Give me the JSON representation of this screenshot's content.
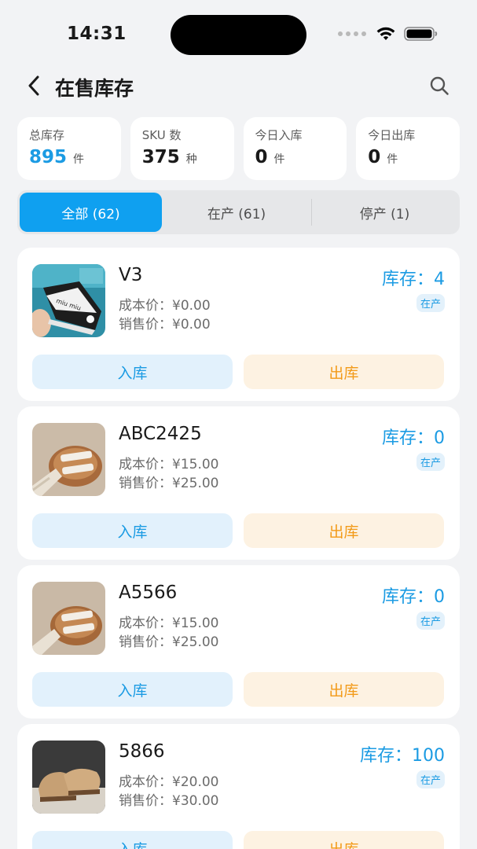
{
  "status_bar": {
    "time": "14:31"
  },
  "nav": {
    "title": "在售库存"
  },
  "stats": [
    {
      "label": "总库存",
      "value": "895",
      "unit": "件"
    },
    {
      "label": "SKU 数",
      "value": "375",
      "unit": "种"
    },
    {
      "label": "今日入库",
      "value": "0",
      "unit": "件"
    },
    {
      "label": "今日出库",
      "value": "0",
      "unit": "件"
    }
  ],
  "tabs": [
    {
      "label": "全部 (62)",
      "active": true
    },
    {
      "label": "在产 (61)",
      "active": false
    },
    {
      "label": "停产 (1)",
      "active": false
    }
  ],
  "products": [
    {
      "name": "V3",
      "cost": "成本价：¥0.00",
      "sale": "销售价：¥0.00",
      "stock": "库存：4",
      "status": "在产",
      "in_label": "入库",
      "out_label": "出库"
    },
    {
      "name": "ABC2425",
      "cost": "成本价：¥15.00",
      "sale": "销售价：¥25.00",
      "stock": "库存：0",
      "status": "在产",
      "in_label": "入库",
      "out_label": "出库"
    },
    {
      "name": "A5566",
      "cost": "成本价：¥15.00",
      "sale": "销售价：¥25.00",
      "stock": "库存：0",
      "status": "在产",
      "in_label": "入库",
      "out_label": "出库"
    },
    {
      "name": "5866",
      "cost": "成本价：¥20.00",
      "sale": "销售价：¥30.00",
      "stock": "库存：100",
      "status": "在产",
      "in_label": "入库",
      "out_label": "出库"
    }
  ],
  "colors": {
    "accent": "#1b9be3",
    "tab_active": "#0fa0f0",
    "out_button": "#f29a18",
    "background": "#f2f3f5"
  },
  "icons": [
    "back-chevron-icon",
    "search-icon",
    "wifi-icon",
    "battery-icon",
    "signal-dots-icon"
  ]
}
